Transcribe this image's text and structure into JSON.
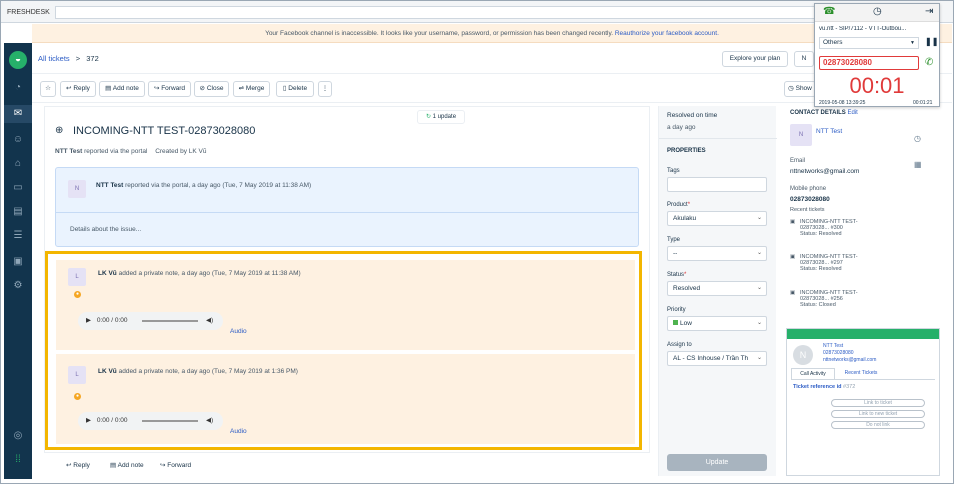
{
  "browser": {
    "brand": "FRESHDESK"
  },
  "banner": {
    "text": "Your Facebook channel is inaccessible. It looks like your username, password, or permission has been changed recently.",
    "link": "Reauthorize your facebook account."
  },
  "header": {
    "breadcrumb_link": "All tickets",
    "sep": ">",
    "ticket_no": "372",
    "explore": "Explore your plan",
    "new_label": "N"
  },
  "toolbar": {
    "reply": "Reply",
    "add_note": "Add note",
    "forward": "Forward",
    "close": "Close",
    "merge": "Merge",
    "delete": "Delete",
    "more": "⋮",
    "show": "Show"
  },
  "ticket": {
    "update_badge": "1 update",
    "title": "INCOMING-NTT TEST-02873028080",
    "requester": "NTT Test",
    "reported": "reported via the portal",
    "created": "Created by LK Vũ",
    "desc_author": "NTT Test",
    "desc_meta": "reported via the portal, a day ago (Tue, 7 May 2019 at 11:38 AM)",
    "desc_body": "Details about the issue...",
    "avatar": "N"
  },
  "notes": [
    {
      "avatar": "L",
      "author": "LK Vũ",
      "meta": "added a private note, a day ago (Tue, 7 May 2019 at 11:38 AM)",
      "time": "0:00 / 0:00",
      "audio": "Audio"
    },
    {
      "avatar": "L",
      "author": "LK Vũ",
      "meta": "added a private note, a day ago (Tue, 7 May 2019 at 1:36 PM)",
      "time": "0:00 / 0:00",
      "audio": "Audio"
    }
  ],
  "bottom": {
    "reply": "Reply",
    "add_note": "Add note",
    "forward": "Forward"
  },
  "props": {
    "resolved_label": "Resolved on time",
    "resolved_value": "a day ago",
    "section": "PROPERTIES",
    "tags": "Tags",
    "product": "Product",
    "product_val": "Akulaku",
    "type": "Type",
    "type_val": "--",
    "status": "Status",
    "status_val": "Resolved",
    "priority": "Priority",
    "priority_val": "Low",
    "assign": "Assign to",
    "assign_val": "AL - CS Inhouse / Trần Th",
    "update": "Update",
    "priority_color": "#4fb34f"
  },
  "contact": {
    "header": "CONTACT DETAILS",
    "edit": "Edit",
    "name": "NTT Test",
    "avatar": "N",
    "email_label": "Email",
    "email": "nttnetworks@gmail.com",
    "mobile_label": "Mobile phone",
    "mobile": "02873028080",
    "recent": "Recent tickets",
    "tickets": [
      {
        "l1": "INCOMING-NTT TEST-",
        "l2": "02873028... #300",
        "status": "Status: Resolved"
      },
      {
        "l1": "INCOMING-NTT TEST-",
        "l2": "02873028... #297",
        "status": "Status: Resolved"
      },
      {
        "l1": "INCOMING-NTT TEST-",
        "l2": "02873028... #256",
        "status": "Status: Closed"
      }
    ]
  },
  "phone": {
    "line": "vu.ntt - SIP/7112 - VTT-Outbou...",
    "select": "Others",
    "number": "02873028080",
    "timer": "00:01",
    "start": "2019-05-08 13:39:25",
    "elapsed": "00:01:21"
  },
  "phone2": {
    "name": "NTT Test",
    "number": "02873028080",
    "email": "nttnetworks@gmail.com",
    "avatar": "N",
    "tab1": "Call Activity",
    "tab2": "Recent Tickets",
    "ref_label": "Ticket reference id",
    "ref_val": "#372",
    "b1": "Link to ticket",
    "b2": "Link to new ticket",
    "b3": "Do not link"
  }
}
